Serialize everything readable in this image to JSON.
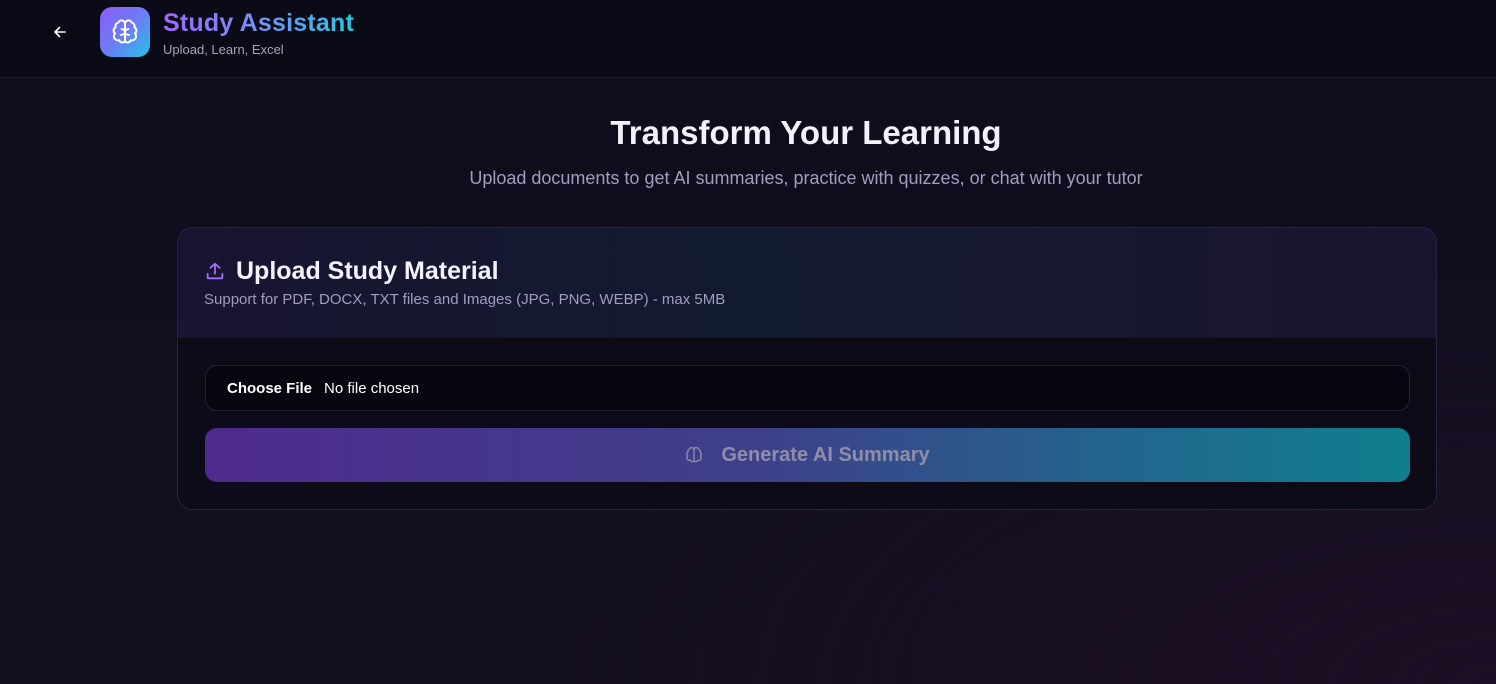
{
  "header": {
    "back_icon": "arrow-left-icon",
    "logo_icon": "brain-icon",
    "title": "Study Assistant",
    "subtitle": "Upload, Learn, Excel"
  },
  "hero": {
    "title": "Transform Your Learning",
    "subtitle": "Upload documents to get AI summaries, practice with quizzes, or chat with your tutor"
  },
  "upload_card": {
    "icon": "upload-icon",
    "title": "Upload Study Material",
    "description": "Support for PDF, DOCX, TXT files and Images (JPG, PNG, WEBP) - max 5MB",
    "file_input": {
      "button_label": "Choose File",
      "status": "No file chosen"
    },
    "generate_button": {
      "icon": "brain-icon",
      "label": "Generate AI Summary",
      "disabled": true
    }
  },
  "colors": {
    "accent_purple": "#8b5cf6",
    "accent_cyan": "#22c3e6",
    "background": "#0d0c1a"
  }
}
